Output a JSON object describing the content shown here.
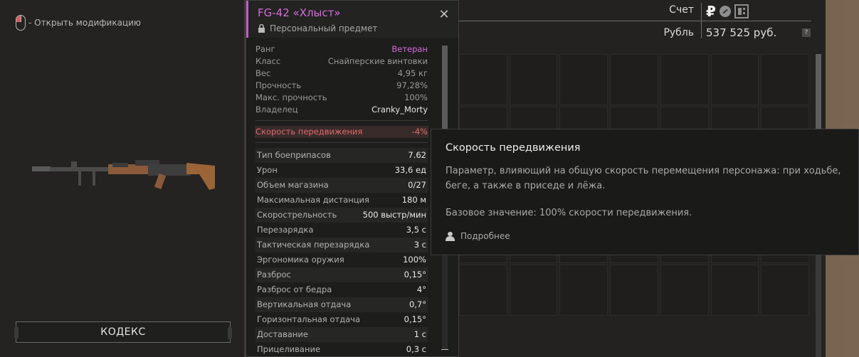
{
  "preview": {
    "mouse_hint": "- Открыть модификацию",
    "codex_label": "КОДЕКС"
  },
  "item": {
    "title": "FG-42 «Хлыст»",
    "subtitle": "Персональный предмет",
    "accent_color": "#d66bde",
    "base_stats": [
      {
        "key": "Ранг",
        "value": "Ветеран"
      },
      {
        "key": "Класс",
        "value": "Снайперские винтовки"
      },
      {
        "key": "Вес",
        "value": "4,95 кг"
      },
      {
        "key": "Прочность",
        "value": "97,28%"
      },
      {
        "key": "Макс. прочность",
        "value": "100%"
      },
      {
        "key": "Владелец",
        "value": "Cranky_Morty"
      }
    ],
    "modifier": {
      "key": "Скорость передвижения",
      "value": "-4%"
    },
    "weapon_stats": [
      {
        "key": "Тип боеприпасов",
        "value": "7.62"
      },
      {
        "key": "Урон",
        "value": "33,6 ед"
      },
      {
        "key": "Объем магазина",
        "value": "0/27"
      },
      {
        "key": "Максимальная дистанция",
        "value": "180 м"
      },
      {
        "key": "Скорострельность",
        "value": "500 выстр/мин"
      },
      {
        "key": "Перезарядка",
        "value": "3,5 с"
      },
      {
        "key": "Тактическая перезарядка",
        "value": "3 с"
      },
      {
        "key": "Эргономика оружия",
        "value": "100%"
      },
      {
        "key": "Разброс",
        "value": "0,15°"
      },
      {
        "key": "Разброс от бедра",
        "value": "4°"
      },
      {
        "key": "Вертикальная отдача",
        "value": "0,7°"
      },
      {
        "key": "Горизонтальная отдача",
        "value": "0,15°"
      },
      {
        "key": "Доставание",
        "value": "1 с"
      },
      {
        "key": "Прицеливание",
        "value": "0,3 с"
      }
    ]
  },
  "account": {
    "label_account": "Счет",
    "label_currency": "Рубль",
    "balance": "537 525 руб.",
    "help": "?",
    "currency_icons": [
      "ruble-icon",
      "coin-icon",
      "chip-icon"
    ]
  },
  "tooltip": {
    "title": "Скорость передвижения",
    "description": "Параметр, влияющий на общую скорость перемещения персонажа: при ходьбе, беге, а также в приседе и лёжа.",
    "base": "Базовое значение: 100% скорости передвижения.",
    "more": "Подробнее"
  }
}
